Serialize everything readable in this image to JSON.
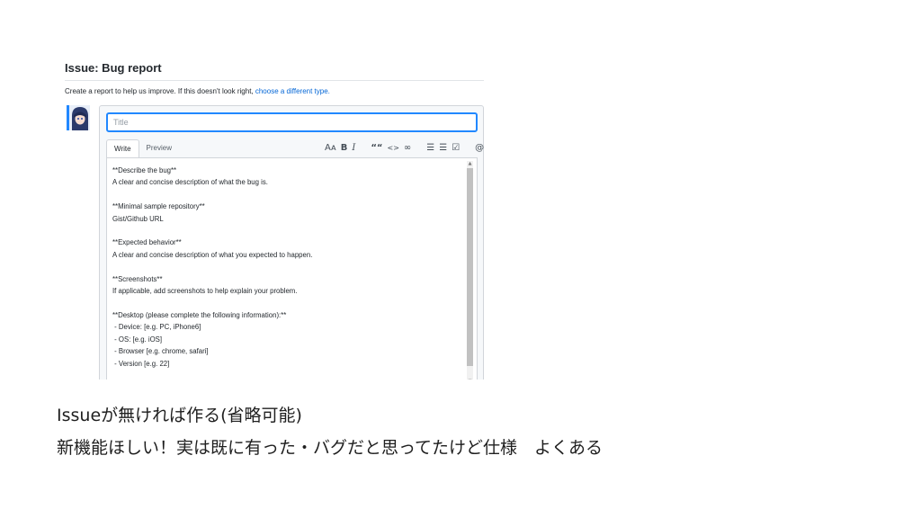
{
  "issue": {
    "title": "Issue: Bug report",
    "description": "Create a report to help us improve. If this doesn't look right, ",
    "link": "choose a different type.",
    "title_placeholder": "Title"
  },
  "tabs": [
    {
      "label": "Write"
    },
    {
      "label": "Preview"
    }
  ],
  "toolbar": {
    "heading": "Aᴀ",
    "bold": "B",
    "italic": "I",
    "quote": "““",
    "code": "<>",
    "link": "∞",
    "bullet_list": "☰",
    "numbered_list": "☰",
    "task_list": "☑",
    "mention": "@",
    "reference": "■",
    "saved_reply": "▾"
  },
  "template_body": "**Describe the bug**\nA clear and concise description of what the bug is.\n\n**Minimal sample repository**\nGist/Github URL\n\n**Expected behavior**\nA clear and concise description of what you expected to happen.\n\n**Screenshots**\nIf applicable, add screenshots to help explain your problem.\n\n**Desktop (please complete the following information):**\n - Device: [e.g. PC, iPhone6]\n - OS: [e.g. iOS]\n - Browser [e.g. chrome, safari]\n - Version [e.g. 22]",
  "captions": {
    "line1": "Issueが無ければ作る(省略可能)",
    "line2": "新機能ほしい！実は既に有った・バグだと思ってたけど仕様　よくある"
  },
  "colors": {
    "accent": "#2188ff",
    "link": "#0366d6",
    "border": "#d1d5da"
  }
}
